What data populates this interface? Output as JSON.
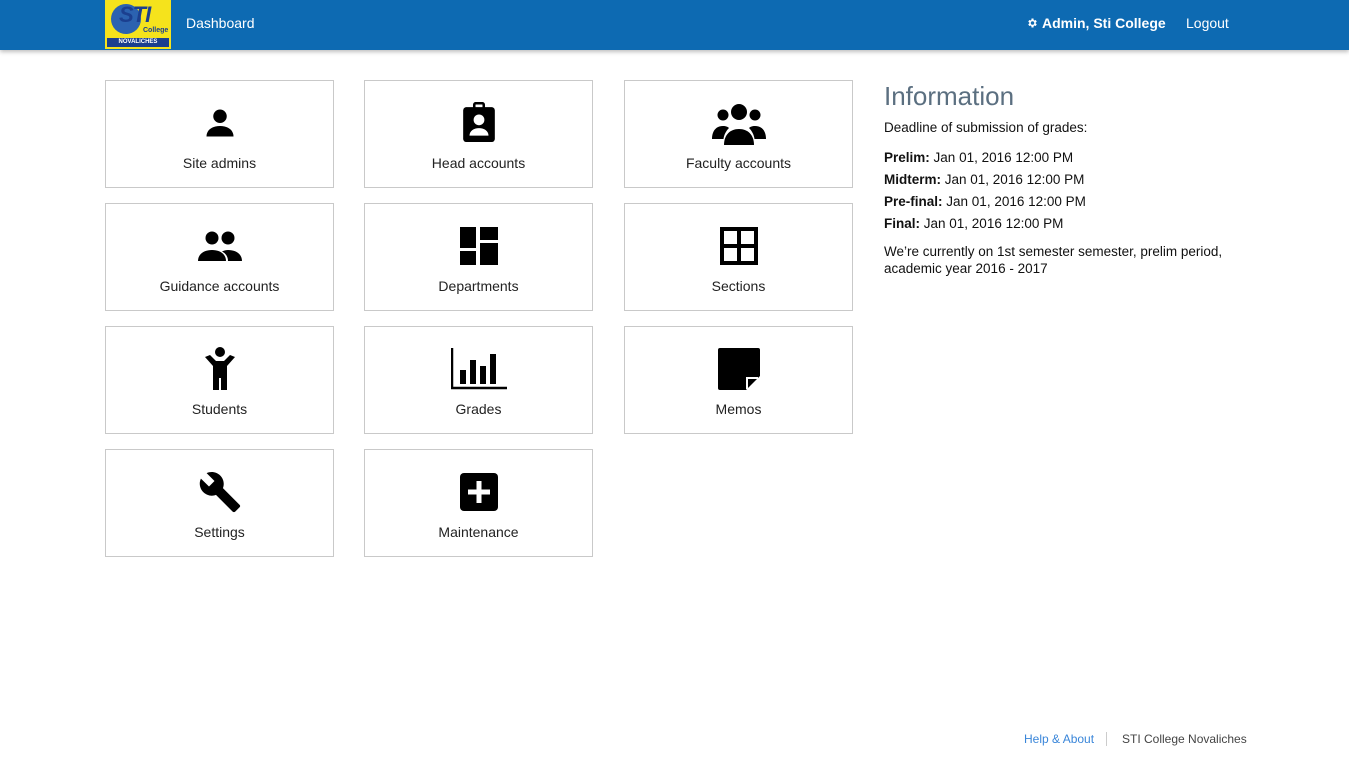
{
  "header": {
    "logo_text": "STI",
    "logo_sub": "College",
    "logo_band": "NOVALICHES",
    "dashboard_label": "Dashboard",
    "user_label": "Admin, Sti College",
    "logout_label": "Logout",
    "bar_color": "#0d6ab2"
  },
  "tiles": [
    {
      "label": "Site admins",
      "icon": "person-icon"
    },
    {
      "label": "Head accounts",
      "icon": "id-badge-icon"
    },
    {
      "label": "Faculty accounts",
      "icon": "group-icon"
    },
    {
      "label": "Guidance accounts",
      "icon": "people-icon"
    },
    {
      "label": "Departments",
      "icon": "dashboard-icon"
    },
    {
      "label": "Sections",
      "icon": "grid-icon"
    },
    {
      "label": "Students",
      "icon": "child-icon"
    },
    {
      "label": "Grades",
      "icon": "bar-chart-icon"
    },
    {
      "label": "Memos",
      "icon": "note-icon"
    },
    {
      "label": "Settings",
      "icon": "wrench-icon"
    },
    {
      "label": "Maintenance",
      "icon": "add-box-icon"
    }
  ],
  "info": {
    "title": "Information",
    "deadline_intro": "Deadline of submission of grades:",
    "deadlines": [
      {
        "term": "Prelim:",
        "date": "Jan 01, 2016 12:00 PM"
      },
      {
        "term": "Midterm:",
        "date": "Jan 01, 2016 12:00 PM"
      },
      {
        "term": "Pre-final:",
        "date": "Jan 01, 2016 12:00 PM"
      },
      {
        "term": "Final:",
        "date": "Jan 01, 2016 12:00 PM"
      }
    ],
    "current": "We’re currently on 1st semester semester, prelim period, academic year 2016 - 2017"
  },
  "footer": {
    "help_label": "Help & About",
    "org_label": "STI College Novaliches"
  }
}
